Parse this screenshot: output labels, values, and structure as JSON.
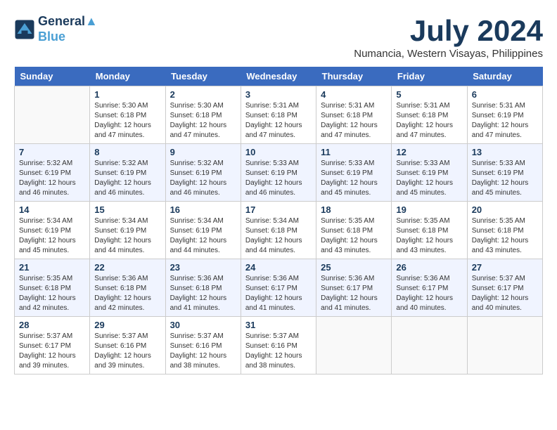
{
  "header": {
    "logo_line1": "General",
    "logo_line2": "Blue",
    "month_title": "July 2024",
    "location": "Numancia, Western Visayas, Philippines"
  },
  "days_of_week": [
    "Sunday",
    "Monday",
    "Tuesday",
    "Wednesday",
    "Thursday",
    "Friday",
    "Saturday"
  ],
  "weeks": [
    [
      {
        "day": "",
        "info": ""
      },
      {
        "day": "1",
        "info": "Sunrise: 5:30 AM\nSunset: 6:18 PM\nDaylight: 12 hours\nand 47 minutes."
      },
      {
        "day": "2",
        "info": "Sunrise: 5:30 AM\nSunset: 6:18 PM\nDaylight: 12 hours\nand 47 minutes."
      },
      {
        "day": "3",
        "info": "Sunrise: 5:31 AM\nSunset: 6:18 PM\nDaylight: 12 hours\nand 47 minutes."
      },
      {
        "day": "4",
        "info": "Sunrise: 5:31 AM\nSunset: 6:18 PM\nDaylight: 12 hours\nand 47 minutes."
      },
      {
        "day": "5",
        "info": "Sunrise: 5:31 AM\nSunset: 6:18 PM\nDaylight: 12 hours\nand 47 minutes."
      },
      {
        "day": "6",
        "info": "Sunrise: 5:31 AM\nSunset: 6:19 PM\nDaylight: 12 hours\nand 47 minutes."
      }
    ],
    [
      {
        "day": "7",
        "info": "Sunrise: 5:32 AM\nSunset: 6:19 PM\nDaylight: 12 hours\nand 46 minutes."
      },
      {
        "day": "8",
        "info": "Sunrise: 5:32 AM\nSunset: 6:19 PM\nDaylight: 12 hours\nand 46 minutes."
      },
      {
        "day": "9",
        "info": "Sunrise: 5:32 AM\nSunset: 6:19 PM\nDaylight: 12 hours\nand 46 minutes."
      },
      {
        "day": "10",
        "info": "Sunrise: 5:33 AM\nSunset: 6:19 PM\nDaylight: 12 hours\nand 46 minutes."
      },
      {
        "day": "11",
        "info": "Sunrise: 5:33 AM\nSunset: 6:19 PM\nDaylight: 12 hours\nand 45 minutes."
      },
      {
        "day": "12",
        "info": "Sunrise: 5:33 AM\nSunset: 6:19 PM\nDaylight: 12 hours\nand 45 minutes."
      },
      {
        "day": "13",
        "info": "Sunrise: 5:33 AM\nSunset: 6:19 PM\nDaylight: 12 hours\nand 45 minutes."
      }
    ],
    [
      {
        "day": "14",
        "info": "Sunrise: 5:34 AM\nSunset: 6:19 PM\nDaylight: 12 hours\nand 45 minutes."
      },
      {
        "day": "15",
        "info": "Sunrise: 5:34 AM\nSunset: 6:19 PM\nDaylight: 12 hours\nand 44 minutes."
      },
      {
        "day": "16",
        "info": "Sunrise: 5:34 AM\nSunset: 6:19 PM\nDaylight: 12 hours\nand 44 minutes."
      },
      {
        "day": "17",
        "info": "Sunrise: 5:34 AM\nSunset: 6:18 PM\nDaylight: 12 hours\nand 44 minutes."
      },
      {
        "day": "18",
        "info": "Sunrise: 5:35 AM\nSunset: 6:18 PM\nDaylight: 12 hours\nand 43 minutes."
      },
      {
        "day": "19",
        "info": "Sunrise: 5:35 AM\nSunset: 6:18 PM\nDaylight: 12 hours\nand 43 minutes."
      },
      {
        "day": "20",
        "info": "Sunrise: 5:35 AM\nSunset: 6:18 PM\nDaylight: 12 hours\nand 43 minutes."
      }
    ],
    [
      {
        "day": "21",
        "info": "Sunrise: 5:35 AM\nSunset: 6:18 PM\nDaylight: 12 hours\nand 42 minutes."
      },
      {
        "day": "22",
        "info": "Sunrise: 5:36 AM\nSunset: 6:18 PM\nDaylight: 12 hours\nand 42 minutes."
      },
      {
        "day": "23",
        "info": "Sunrise: 5:36 AM\nSunset: 6:18 PM\nDaylight: 12 hours\nand 41 minutes."
      },
      {
        "day": "24",
        "info": "Sunrise: 5:36 AM\nSunset: 6:17 PM\nDaylight: 12 hours\nand 41 minutes."
      },
      {
        "day": "25",
        "info": "Sunrise: 5:36 AM\nSunset: 6:17 PM\nDaylight: 12 hours\nand 41 minutes."
      },
      {
        "day": "26",
        "info": "Sunrise: 5:36 AM\nSunset: 6:17 PM\nDaylight: 12 hours\nand 40 minutes."
      },
      {
        "day": "27",
        "info": "Sunrise: 5:37 AM\nSunset: 6:17 PM\nDaylight: 12 hours\nand 40 minutes."
      }
    ],
    [
      {
        "day": "28",
        "info": "Sunrise: 5:37 AM\nSunset: 6:17 PM\nDaylight: 12 hours\nand 39 minutes."
      },
      {
        "day": "29",
        "info": "Sunrise: 5:37 AM\nSunset: 6:16 PM\nDaylight: 12 hours\nand 39 minutes."
      },
      {
        "day": "30",
        "info": "Sunrise: 5:37 AM\nSunset: 6:16 PM\nDaylight: 12 hours\nand 38 minutes."
      },
      {
        "day": "31",
        "info": "Sunrise: 5:37 AM\nSunset: 6:16 PM\nDaylight: 12 hours\nand 38 minutes."
      },
      {
        "day": "",
        "info": ""
      },
      {
        "day": "",
        "info": ""
      },
      {
        "day": "",
        "info": ""
      }
    ]
  ]
}
